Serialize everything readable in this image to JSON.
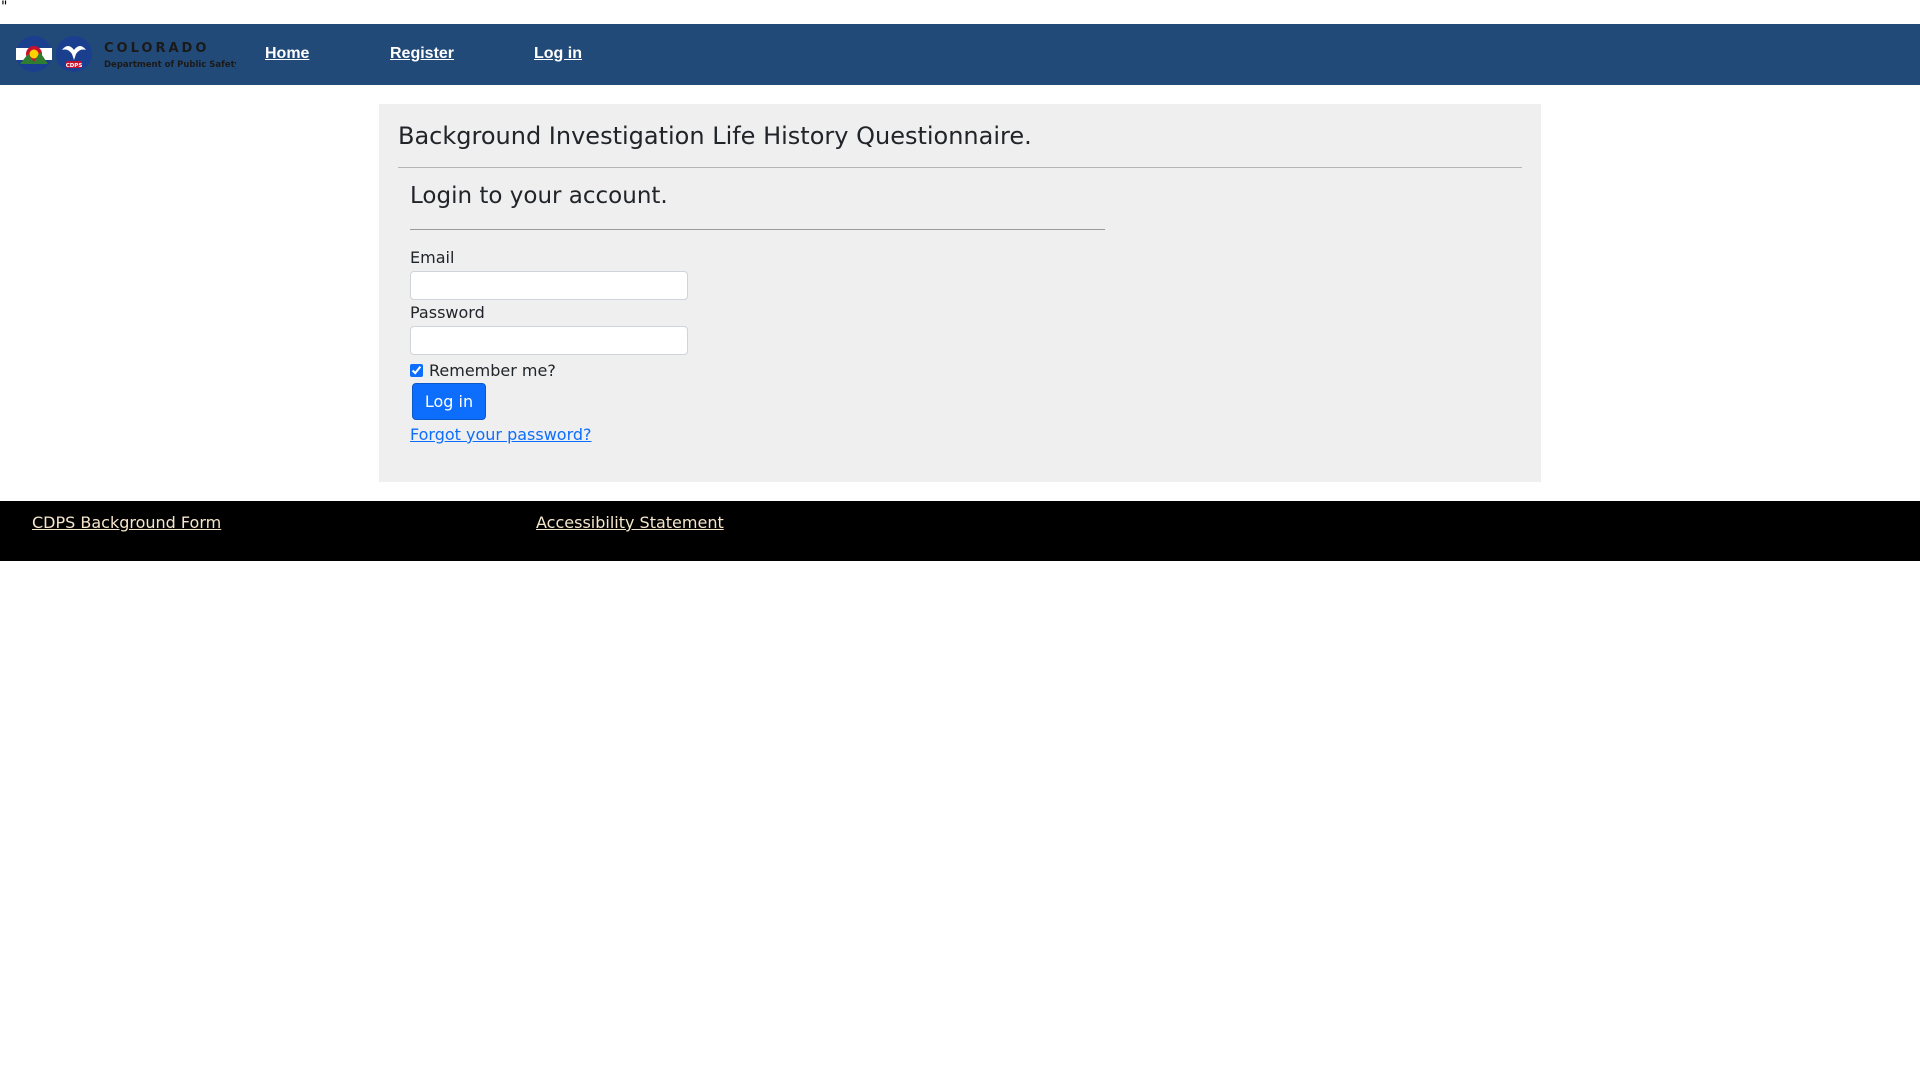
{
  "stray_text": "\"",
  "nav": {
    "logo_text": {
      "state": "COLORADO",
      "department": "Department of Public Safety",
      "seal": "CDPS"
    },
    "links": [
      "Home",
      "Register",
      "Log in"
    ]
  },
  "card": {
    "title": "Background Investigation Life History Questionnaire.",
    "login": {
      "heading": "Login to your account.",
      "email_label": "Email",
      "email_value": "",
      "password_label": "Password",
      "password_value": "",
      "remember_label": "Remember me?",
      "remember_checked": true,
      "submit_label": "Log in",
      "forgot_label": "Forgot your password?"
    }
  },
  "footer": {
    "links": [
      "CDPS Background Form",
      "Accessibility Statement"
    ]
  },
  "colors": {
    "nav_bg": "#224a78",
    "card_bg": "#efefef",
    "primary": "#0d6efd",
    "footer_bg": "#000000",
    "footer_link": "#f5e6cc"
  },
  "icons": [
    "colorado-flag-logo-icon",
    "cdps-eagle-seal-icon"
  ]
}
